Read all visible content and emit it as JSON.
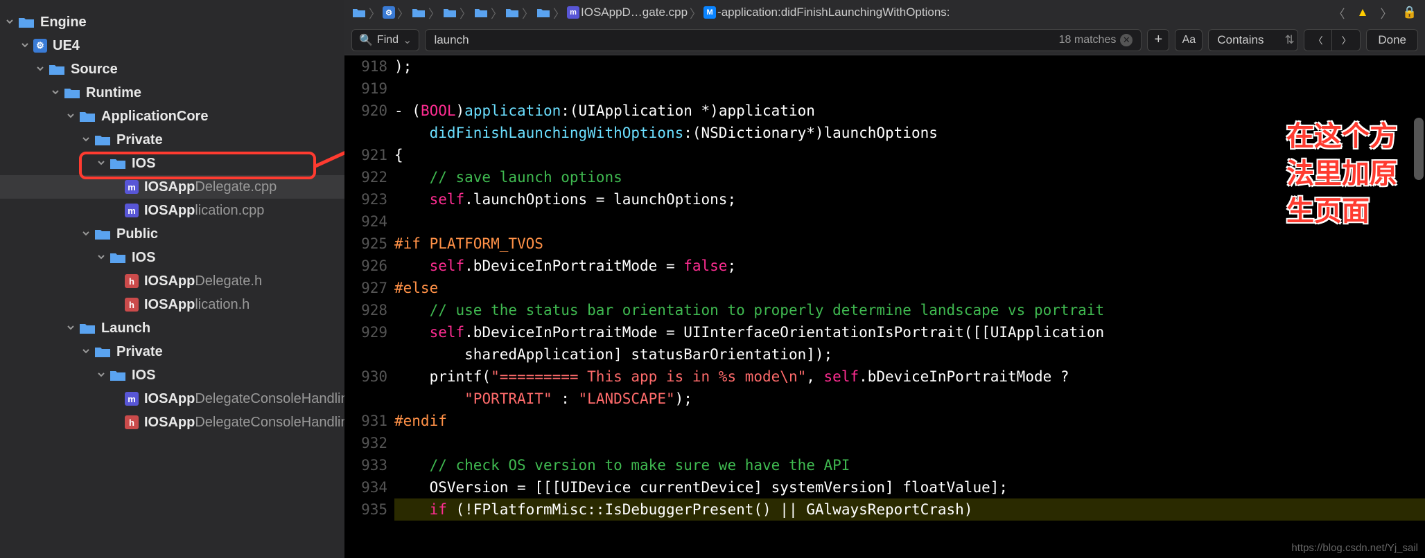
{
  "sidebar": {
    "items": [
      {
        "indent": 0,
        "chev": true,
        "icon": "folder",
        "bold": "Engine",
        "dim": ""
      },
      {
        "indent": 1,
        "chev": true,
        "icon": "ue",
        "bold": "UE4",
        "dim": ""
      },
      {
        "indent": 2,
        "chev": true,
        "icon": "folder",
        "bold": "Source",
        "dim": ""
      },
      {
        "indent": 3,
        "chev": true,
        "icon": "folder",
        "bold": "Runtime",
        "dim": ""
      },
      {
        "indent": 4,
        "chev": true,
        "icon": "folder",
        "bold": "ApplicationCore",
        "dim": ""
      },
      {
        "indent": 5,
        "chev": true,
        "icon": "folder",
        "bold": "Private",
        "dim": ""
      },
      {
        "indent": 6,
        "chev": true,
        "icon": "folder",
        "bold": "IOS",
        "dim": ""
      },
      {
        "indent": 7,
        "chev": false,
        "icon": "m",
        "bold": "IOSApp",
        "dim": "Delegate.cpp",
        "selected": true
      },
      {
        "indent": 7,
        "chev": false,
        "icon": "m",
        "bold": "IOSApp",
        "dim": "lication.cpp"
      },
      {
        "indent": 5,
        "chev": true,
        "icon": "folder",
        "bold": "Public",
        "dim": ""
      },
      {
        "indent": 6,
        "chev": true,
        "icon": "folder",
        "bold": "IOS",
        "dim": ""
      },
      {
        "indent": 7,
        "chev": false,
        "icon": "h",
        "bold": "IOSApp",
        "dim": "Delegate.h"
      },
      {
        "indent": 7,
        "chev": false,
        "icon": "h",
        "bold": "IOSApp",
        "dim": "lication.h"
      },
      {
        "indent": 4,
        "chev": true,
        "icon": "folder",
        "bold": "Launch",
        "dim": ""
      },
      {
        "indent": 5,
        "chev": true,
        "icon": "folder",
        "bold": "Private",
        "dim": ""
      },
      {
        "indent": 6,
        "chev": true,
        "icon": "folder",
        "bold": "IOS",
        "dim": ""
      },
      {
        "indent": 7,
        "chev": false,
        "icon": "m",
        "bold": "IOSApp",
        "dim": "DelegateConsoleHandlin..."
      },
      {
        "indent": 7,
        "chev": false,
        "icon": "h",
        "bold": "IOSApp",
        "dim": "DelegateConsoleHandlin..."
      }
    ]
  },
  "breadcrumb": {
    "file_label": "IOSAppD…gate.cpp",
    "method_label": "-application:didFinishLaunchingWithOptions:"
  },
  "findbar": {
    "mode": "Find",
    "query": "launch",
    "matches": "18 matches",
    "contains": "Contains",
    "done": "Done",
    "aa": "Aa"
  },
  "editor": {
    "lines": [
      {
        "n": "918",
        "html": ");"
      },
      {
        "n": "919",
        "html": ""
      },
      {
        "n": "920",
        "html": "- (<span class='c-kw'>BOOL</span>)<span class='c-type'>application</span>:(UIApplication *)application"
      },
      {
        "n": "",
        "html": "    <span class='c-type'>didFinishLaunchingWithOptions</span>:(NSDictionary*)launchOptions"
      },
      {
        "n": "921",
        "html": "{"
      },
      {
        "n": "922",
        "html": "    <span class='c-com'>// save launch options</span>"
      },
      {
        "n": "923",
        "html": "    <span class='c-self'>self</span>.launchOptions = launchOptions;"
      },
      {
        "n": "924",
        "html": ""
      },
      {
        "n": "925",
        "html": "<span class='c-macro'>#if PLATFORM_TVOS</span>"
      },
      {
        "n": "926",
        "html": "    <span class='c-self'>self</span>.bDeviceInPortraitMode = <span class='c-bool'>false</span>;"
      },
      {
        "n": "927",
        "html": "<span class='c-macro'>#else</span>"
      },
      {
        "n": "928",
        "html": "    <span class='c-com'>// use the status bar orientation to properly determine landscape vs portrait</span>"
      },
      {
        "n": "929",
        "html": "    <span class='c-self'>self</span>.bDeviceInPortraitMode = UIInterfaceOrientationIsPortrait([[UIApplication"
      },
      {
        "n": "",
        "html": "        sharedApplication] statusBarOrientation]);"
      },
      {
        "n": "930",
        "html": "    printf(<span class='c-str'>\"========= This app is in %s mode\\n\"</span>, <span class='c-self'>self</span>.bDeviceInPortraitMode ?"
      },
      {
        "n": "",
        "html": "        <span class='c-str'>\"PORTRAIT\"</span> : <span class='c-str'>\"LANDSCAPE\"</span>);"
      },
      {
        "n": "931",
        "html": "<span class='c-macro'>#endif</span>"
      },
      {
        "n": "932",
        "html": ""
      },
      {
        "n": "933",
        "html": "    <span class='c-com'>// check OS version to make sure we have the API</span>"
      },
      {
        "n": "934",
        "html": "    OSVersion = [[[UIDevice currentDevice] systemVersion] floatValue];"
      },
      {
        "n": "935",
        "html": "    <span class='c-kw'>if</span> (!FPlatformMisc::IsDebuggerPresent() || GAlwaysReportCrash)",
        "hl": true
      }
    ]
  },
  "annotation": {
    "line1": "在这个方",
    "line2": "法里加原",
    "line3": "生页面"
  },
  "watermark": "https://blog.csdn.net/Yj_sail"
}
